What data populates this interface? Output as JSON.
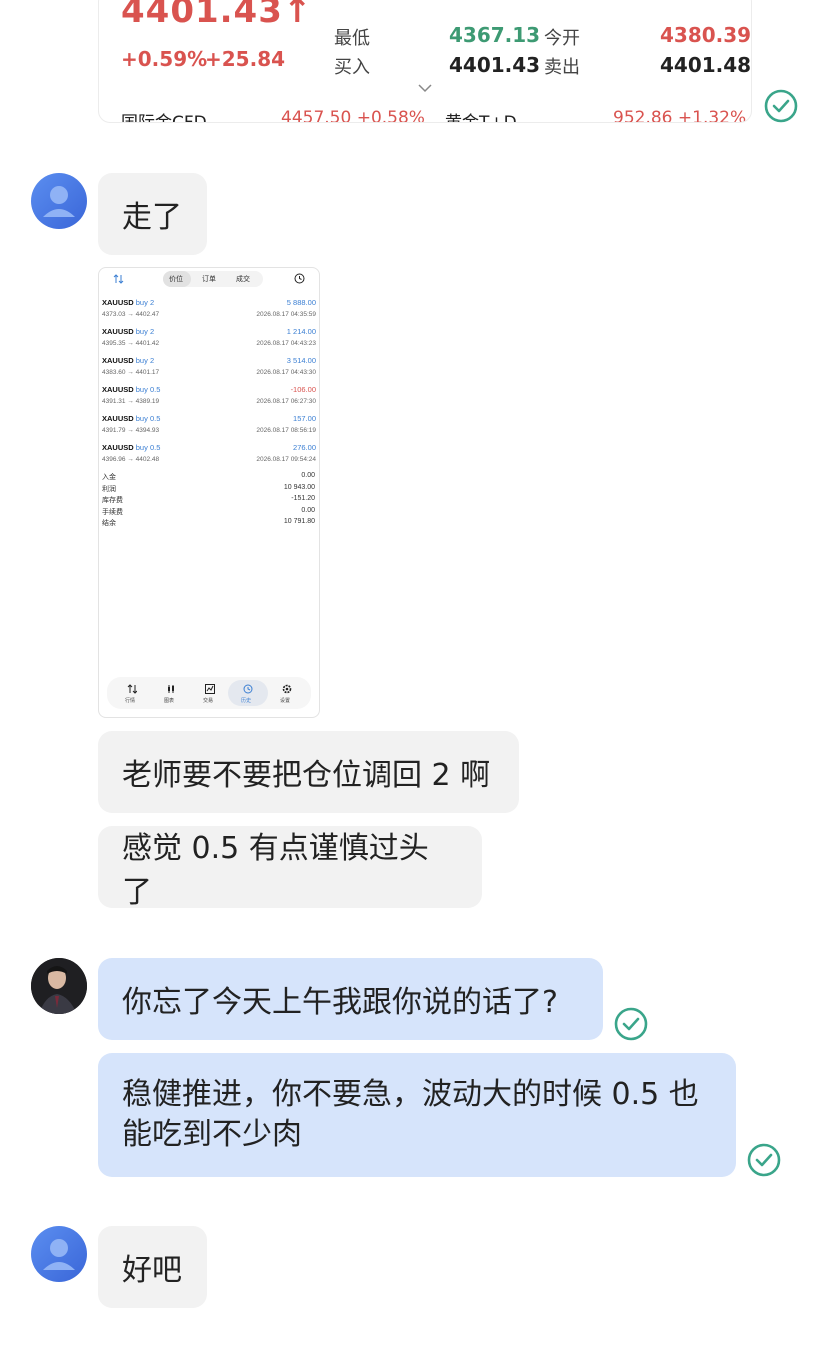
{
  "quote": {
    "price": "4401.43↑",
    "change_pct": "+0.59%",
    "change_abs": "+25.84",
    "low_label": "最低",
    "low_value": "4367.13",
    "open_label": "今开",
    "open_value": "4380.39",
    "buy_label": "买入",
    "buy_value": "4401.43",
    "sell_label": "卖出",
    "sell_value": "4401.48",
    "cfd_label": "国际金CFD",
    "cfd_value": "4457.50 +0.58%",
    "td_label": "黄金T+D",
    "td_value": "952.86 +1.32%"
  },
  "messages": {
    "m1": "走了",
    "m2": "老师要不要把仓位调回 2 啊",
    "m3": "感觉 0.5 有点谨慎过头了",
    "m4": "你忘了今天上午我跟你说的话了?",
    "m5_line1": "稳健推进，你不要急，波动大的时候 0.5 也",
    "m5_line2": "能吃到不少肉",
    "m6": "好吧"
  },
  "shot": {
    "tabs": [
      "价位",
      "订单",
      "成交"
    ],
    "trades": [
      {
        "symbol": "XAUUSD",
        "side": "buy 2",
        "range": "4373.03 → 4402.47",
        "profit": "5 888.00",
        "time": "2026.08.17 04:35:59",
        "loss": false
      },
      {
        "symbol": "XAUUSD",
        "side": "buy 2",
        "range": "4395.35 → 4401.42",
        "profit": "1 214.00",
        "time": "2026.08.17 04:43:23",
        "loss": false
      },
      {
        "symbol": "XAUUSD",
        "side": "buy 2",
        "range": "4383.60 → 4401.17",
        "profit": "3 514.00",
        "time": "2026.08.17 04:43:30",
        "loss": false
      },
      {
        "symbol": "XAUUSD",
        "side": "buy 0.5",
        "range": "4391.31 → 4389.19",
        "profit": "-106.00",
        "time": "2026.08.17 06:27:30",
        "loss": true
      },
      {
        "symbol": "XAUUSD",
        "side": "buy 0.5",
        "range": "4391.79 → 4394.93",
        "profit": "157.00",
        "time": "2026.08.17 08:56:19",
        "loss": false
      },
      {
        "symbol": "XAUUSD",
        "side": "buy 0.5",
        "range": "4396.96 → 4402.48",
        "profit": "276.00",
        "time": "2026.08.17 09:54:24",
        "loss": false
      }
    ],
    "summary": [
      {
        "label": "入金",
        "value": "0.00"
      },
      {
        "label": "利润",
        "value": "10 943.00"
      },
      {
        "label": "库存费",
        "value": "-151.20"
      },
      {
        "label": "手续费",
        "value": "0.00"
      },
      {
        "label": "结余",
        "value": "10 791.80"
      }
    ],
    "nav": [
      "行情",
      "图表",
      "交易",
      "历史",
      "设置"
    ]
  },
  "colors": {
    "up_red": "#d9534f",
    "down_green": "#3d9a73",
    "bubble_other": "#f2f2f2",
    "bubble_me": "#d6e4fb",
    "read_check": "#3aa58a"
  }
}
